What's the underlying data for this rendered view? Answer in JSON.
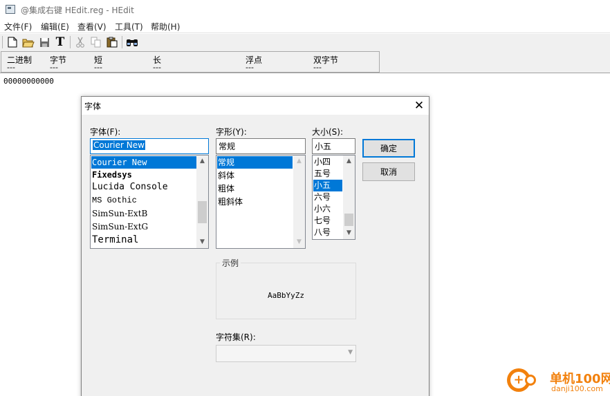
{
  "window": {
    "title": "@集成右键 HEdit.reg - HEdit"
  },
  "menu": [
    "文件(F)",
    "编辑(E)",
    "查看(V)",
    "工具(T)",
    "帮助(H)"
  ],
  "toolbar": {
    "icons": [
      "new-file-icon",
      "open-folder-icon",
      "save-icon",
      "font-icon",
      "cut-icon",
      "copy-icon",
      "paste-icon",
      "find-icon"
    ],
    "font_glyph": "T"
  },
  "typebar": {
    "labels": [
      "二进制",
      "字节",
      "短",
      "长",
      "浮点",
      "双字节"
    ],
    "values": [
      "---",
      "---",
      "---",
      "---",
      "---",
      "---"
    ]
  },
  "content": {
    "hex_text": "00000000000"
  },
  "font_dialog": {
    "title": "字体",
    "close_glyph": "✕",
    "font_label": "字体(F):",
    "font_value": "Courier New",
    "fonts": [
      "Courier New",
      "Fixedsys",
      "Lucida Console",
      "MS Gothic",
      "SimSun-ExtB",
      "SimSun-ExtG",
      "Terminal"
    ],
    "style_label": "字形(Y):",
    "style_value": "常规",
    "styles": [
      "常规",
      "斜体",
      "粗体",
      "粗斜体"
    ],
    "size_label": "大小(S):",
    "size_value": "小五",
    "sizes": [
      "小四",
      "五号",
      "小五",
      "六号",
      "小六",
      "七号",
      "八号"
    ],
    "ok_label": "确定",
    "cancel_label": "取消",
    "sample_label": "示例",
    "sample_text": "AaBbYyZz",
    "charset_label": "字符集(R):",
    "charset_value": ""
  },
  "watermark": {
    "line1": "单机100网",
    "line2": "danji100.com"
  },
  "colors": {
    "selection": "#0078d7",
    "accent_default_button": "#0078d7",
    "watermark": "#f2810d"
  }
}
